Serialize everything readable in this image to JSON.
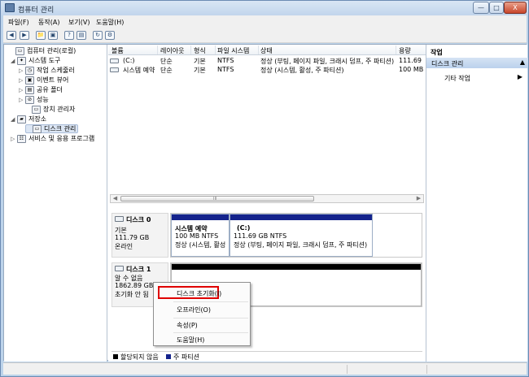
{
  "window": {
    "title": "컴퓨터 관리",
    "min": "—",
    "max": "□",
    "close": "X"
  },
  "menu": [
    "파일(F)",
    "동작(A)",
    "보기(V)",
    "도움말(H)"
  ],
  "toolbar": [
    "◀",
    "▶",
    "📁",
    "▣",
    "?",
    "▤",
    "↻",
    "⚙"
  ],
  "tree": [
    {
      "label": "컴퓨터 관리(로컬)",
      "icon": "computer-icon",
      "exp": "",
      "level": 0
    },
    {
      "label": "시스템 도구",
      "icon": "tools-icon",
      "exp": "◢",
      "level": 1
    },
    {
      "label": "작업 스케줄러",
      "icon": "scheduler-icon",
      "exp": "▷",
      "level": 2
    },
    {
      "label": "이벤트 뷰어",
      "icon": "event-viewer-icon",
      "exp": "▷",
      "level": 2
    },
    {
      "label": "공유 폴더",
      "icon": "shared-folder-icon",
      "exp": "▷",
      "level": 2
    },
    {
      "label": "성능",
      "icon": "performance-icon",
      "exp": "▷",
      "level": 2
    },
    {
      "label": "장치 관리자",
      "icon": "device-manager-icon",
      "exp": "",
      "level": 2
    },
    {
      "label": "저장소",
      "icon": "storage-icon",
      "exp": "◢",
      "level": 1
    },
    {
      "label": "디스크 관리",
      "icon": "disk-management-icon",
      "exp": "",
      "level": 2,
      "selected": true
    },
    {
      "label": "서비스 및 응용 프로그램",
      "icon": "services-icon",
      "exp": "▷",
      "level": 1
    }
  ],
  "volumes": {
    "headers": [
      "볼륨",
      "레이아웃",
      "형식",
      "파일 시스템",
      "상태",
      "용량"
    ],
    "rows": [
      [
        "(C:)",
        "단순",
        "기본",
        "NTFS",
        "정상 (부팅, 페이지 파일, 크래시 덤프, 주 파티션)",
        "111.69"
      ],
      [
        "시스템 예약",
        "단순",
        "기본",
        "NTFS",
        "정상 (시스템, 활성, 주 파티션)",
        "100 MB"
      ]
    ],
    "scroll_grip": "III"
  },
  "disks": [
    {
      "name": "디스크 0",
      "type": "기본",
      "size": "111.79 GB",
      "state": "온라인",
      "partitions": [
        {
          "title": "시스템 예약",
          "size": "100 MB NTFS",
          "status": "정상 (시스템, 활성"
        },
        {
          "title": "(C:)",
          "size": "111.69 GB NTFS",
          "status": "정상 (부팅, 페이지 파일, 크래시 덤프, 주 파티션)"
        }
      ]
    },
    {
      "name": "디스크 1",
      "type": "알 수 없음",
      "size": "1862.89 GB",
      "state": "초기화 안 됨",
      "partitions": []
    }
  ],
  "context_menu": [
    "디스크 초기화(I)",
    "오프라인(O)",
    "속성(P)",
    "도움말(H)"
  ],
  "legend": [
    {
      "label": "할당되지 않음",
      "color": "#000000"
    },
    {
      "label": "주 파티션",
      "color": "#14238c"
    }
  ],
  "actions": {
    "title": "작업",
    "main": "디스크 관리",
    "sub": "기타 작업",
    "chevron": "▲",
    "arrow": "▶"
  }
}
